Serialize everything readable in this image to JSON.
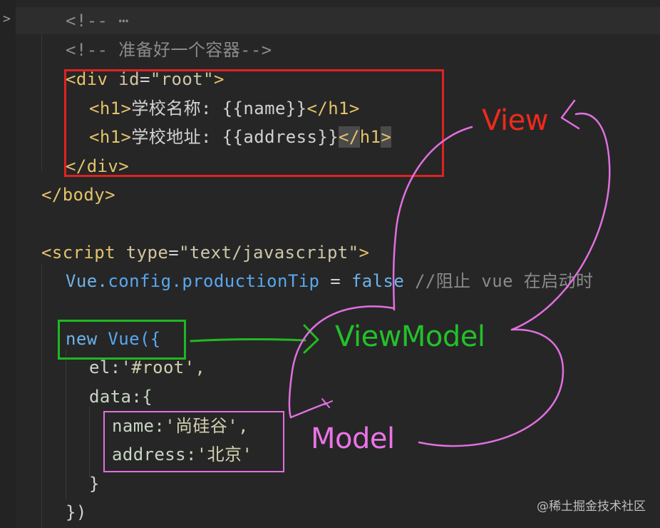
{
  "editor": {
    "fold_marker": ">",
    "lines": {
      "l1": "<!-- ⋯",
      "l2": "<!-- 准备好一个容器-->",
      "l3_open": "<",
      "l3_tag": "div",
      "l3_attr": " id",
      "l3_eq": "=",
      "l3_val": "\"root\"",
      "l3_close": ">",
      "l4_open": "<h1>",
      "l4_text": "学校名称: {{name}}",
      "l4_close": "</h1>",
      "l5_open": "<h1>",
      "l5_text": "学校地址: {{address}}",
      "l5_close_a": "</",
      "l5_close_b": "h1",
      "l5_close_c": ">",
      "l6": "</div>",
      "l7": "</body>",
      "l8_open": "<script",
      "l8_attr": " type",
      "l8_eq": "=",
      "l8_val": "\"text/javascript\"",
      "l8_close": ">",
      "l9_obj": "Vue.",
      "l9_prop": "config.productionTip",
      "l9_rest": " = ",
      "l9_kw": "false",
      "l9_com": " //阻止 vue 在启动时",
      "l10_kw": "new",
      "l10_rest": " Vue({",
      "l11": "el:",
      "l11_val": "'#root',",
      "l12": "data:{",
      "l13_key": "name:",
      "l13_val": "'尚硅谷',",
      "l14_key": "address:",
      "l14_val": "'北京'",
      "l15": "}",
      "l16": "})"
    }
  },
  "annotations": {
    "view": "View",
    "viewmodel": "ViewModel",
    "model": "Model"
  },
  "colors": {
    "view_box": "#e02222",
    "viewmodel_box": "#1fb821",
    "model_box": "#e070e0"
  },
  "watermark": "@稀土掘金技术社区"
}
